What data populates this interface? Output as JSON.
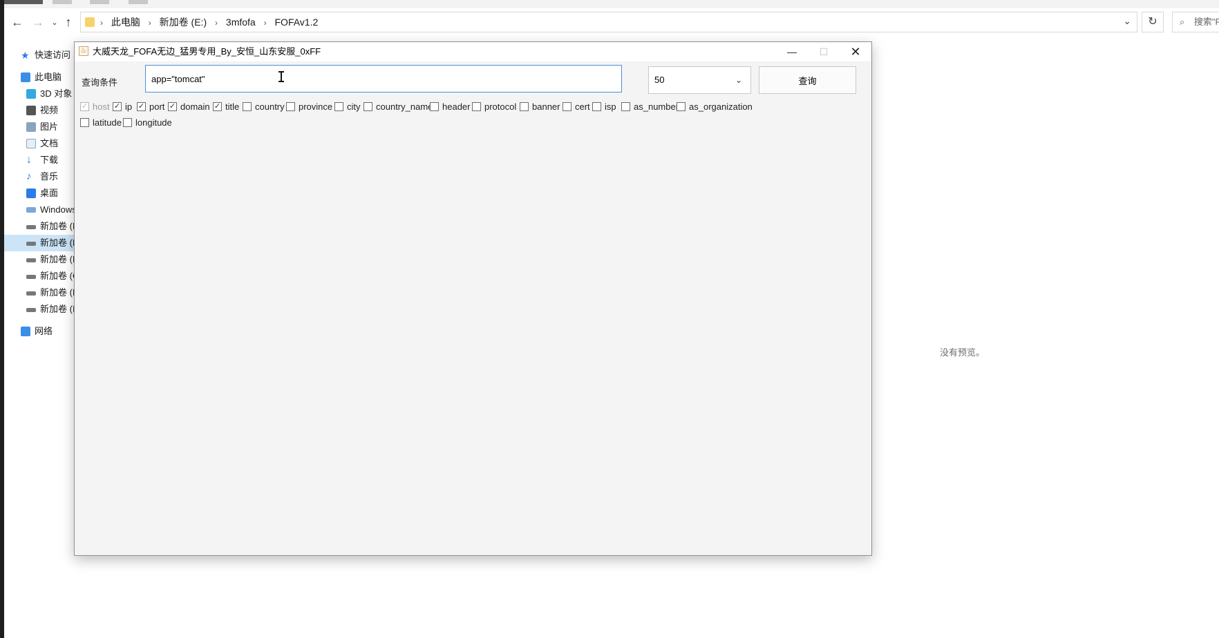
{
  "explorer": {
    "breadcrumb": [
      "此电脑",
      "新加卷 (E:)",
      "3mfofa",
      "FOFAv1.2"
    ],
    "search_placeholder": "搜索\"F",
    "preview_text": "没有预览。",
    "sidebar": [
      {
        "label": "快速访问",
        "icon": "star-icon"
      },
      {
        "label": "此电脑",
        "icon": "computer-icon"
      },
      {
        "label": "3D 对象",
        "icon": "cube-icon"
      },
      {
        "label": "视频",
        "icon": "video-icon"
      },
      {
        "label": "图片",
        "icon": "picture-icon"
      },
      {
        "label": "文档",
        "icon": "document-icon"
      },
      {
        "label": "下载",
        "icon": "download-icon"
      },
      {
        "label": "音乐",
        "icon": "music-icon"
      },
      {
        "label": "桌面",
        "icon": "desktop-icon"
      },
      {
        "label": "Windows",
        "icon": "drive-icon"
      },
      {
        "label": "新加卷 (D",
        "icon": "drive-icon"
      },
      {
        "label": "新加卷 (E",
        "icon": "drive-icon"
      },
      {
        "label": "新加卷 (F",
        "icon": "drive-icon"
      },
      {
        "label": "新加卷 (G",
        "icon": "drive-icon"
      },
      {
        "label": "新加卷 (H",
        "icon": "drive-icon"
      },
      {
        "label": "新加卷 (I",
        "icon": "drive-icon"
      },
      {
        "label": "网络",
        "icon": "network-icon"
      }
    ]
  },
  "dialog": {
    "title": "大威天龙_FOFA无边_猛男专用_By_安恒_山东安服_0xFF",
    "query_label": "查询条件",
    "query_value": "app=\"tomcat\"",
    "count_value": "50",
    "query_button": "查询",
    "fields": [
      {
        "label": "host",
        "checked": true,
        "disabled": true
      },
      {
        "label": "ip",
        "checked": true,
        "disabled": false
      },
      {
        "label": "port",
        "checked": true,
        "disabled": false
      },
      {
        "label": "domain",
        "checked": true,
        "disabled": false
      },
      {
        "label": "title",
        "checked": true,
        "disabled": false
      },
      {
        "label": "country",
        "checked": false,
        "disabled": false
      },
      {
        "label": "province",
        "checked": false,
        "disabled": false
      },
      {
        "label": "city",
        "checked": false,
        "disabled": false
      },
      {
        "label": "country_name",
        "checked": false,
        "disabled": false
      },
      {
        "label": "header",
        "checked": false,
        "disabled": false
      },
      {
        "label": "protocol",
        "checked": false,
        "disabled": false
      },
      {
        "label": "banner",
        "checked": false,
        "disabled": false
      },
      {
        "label": "cert",
        "checked": false,
        "disabled": false
      },
      {
        "label": "isp",
        "checked": false,
        "disabled": false
      },
      {
        "label": "as_number",
        "checked": false,
        "disabled": false
      },
      {
        "label": "as_organization",
        "checked": false,
        "disabled": false
      },
      {
        "label": "latitude",
        "checked": false,
        "disabled": false
      },
      {
        "label": "longitude",
        "checked": false,
        "disabled": false
      }
    ]
  },
  "colors": {
    "accent": "#4a90d9",
    "selected_nav": "#cce4f7",
    "window_bg": "#f4f4f4"
  }
}
